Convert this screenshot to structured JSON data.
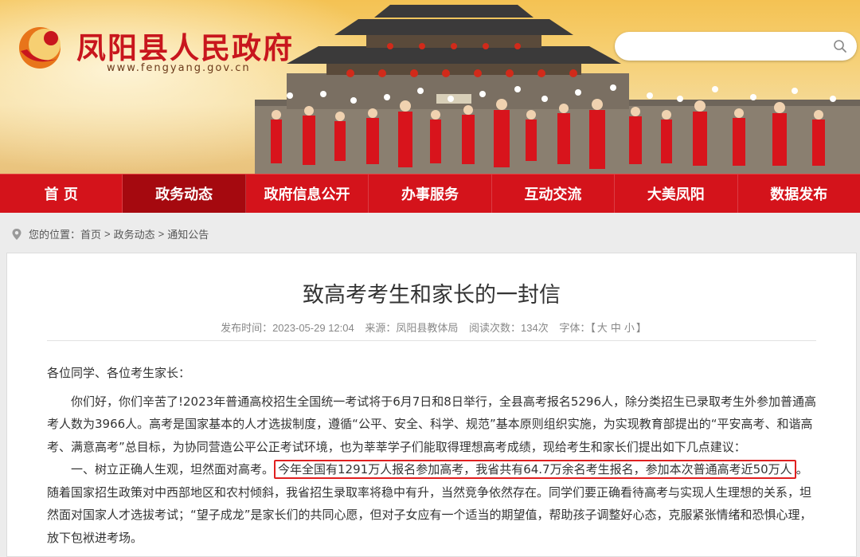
{
  "header": {
    "site_title": "凤阳县人民政府",
    "site_url": "www.fengyang.gov.cn",
    "search_placeholder": ""
  },
  "nav": {
    "items": [
      {
        "label": "首 页"
      },
      {
        "label": "政务动态"
      },
      {
        "label": "政府信息公开"
      },
      {
        "label": "办事服务"
      },
      {
        "label": "互动交流"
      },
      {
        "label": "大美凤阳"
      },
      {
        "label": "数据发布"
      }
    ],
    "active_index": 1
  },
  "breadcrumb": {
    "prefix": "您的位置：",
    "items": [
      "首页",
      "政务动态",
      "通知公告"
    ],
    "sep": ">"
  },
  "article": {
    "title": "致高考考生和家长的一封信",
    "meta": {
      "publish_time": "发布时间：2023-05-29 12:04",
      "source": "来源：凤阳县教体局",
      "views": "阅读次数：134次",
      "font_size_label": "字体：【",
      "font_large": "大",
      "font_medium": "中",
      "font_small": "小",
      "font_close": "】"
    },
    "greeting": "各位同学、各位考生家长：",
    "para1": "你们好，你们辛苦了!2023年普通高校招生全国统一考试将于6月7日和8日举行，全县高考报名5296人，除分类招生已录取考生外参加普通高考人数为3966人。高考是国家基本的人才选拔制度，遵循“公平、安全、科学、规范”基本原则组织实施，为实现教育部提出的“平安高考、和谐高考、满意高考”总目标，为协同营造公平公正考试环境，也为莘莘学子们能取得理想高考成绩，现给考生和家长们提出如下几点建议：",
    "para2_lead": "一、树立正确人生观，坦然面对高考。",
    "para2_highlight": "今年全国有1291万人报名参加高考，我省共有64.7万余名考生报名，参加本次普通高考近50万人",
    "para2_rest": "。随着国家招生政策对中西部地区和农村倾斜，我省招生录取率将稳中有升，当然竞争依然存在。同学们要正确看待高考与实现人生理想的关系，坦然面对国家人才选拔考试；“望子成龙”是家长们的共同心愿，但对子女应有一个适当的期望值，帮助孩子调整好心态，克服紧张情绪和恐惧心理，放下包袱进考场。"
  },
  "colors": {
    "brand_red": "#d4131b",
    "nav_active": "#a5090f",
    "highlight_border": "#e02020"
  },
  "icons": [
    "logo-emblem",
    "search-icon",
    "location-pin-icon"
  ]
}
